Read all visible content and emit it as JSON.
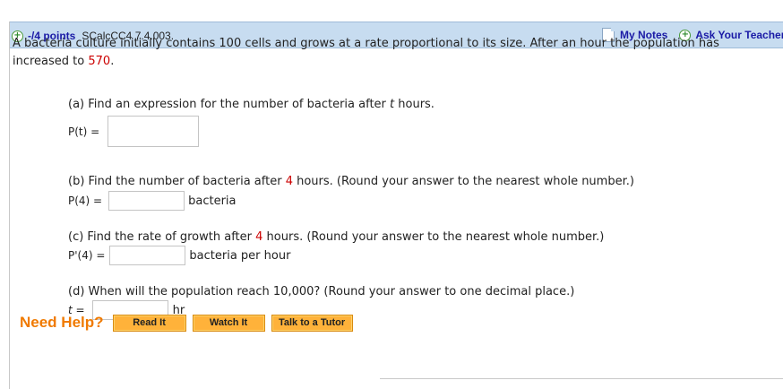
{
  "header": {
    "points": "-/4 points",
    "question_id": "SCalcCC4 7.4.003.",
    "my_notes": "My Notes",
    "ask_teacher": "Ask Your Teacher"
  },
  "problem": {
    "text": "A bacteria culture initially contains 100 cells and grows at a rate proportional to its size. After an hour the population has increased to ",
    "value": "570",
    "end": "."
  },
  "part_a": {
    "prompt_start": "(a) Find an expression for the number of bacteria after ",
    "var": "t",
    "prompt_end": " hours.",
    "label": "P(t) =",
    "value": ""
  },
  "part_b": {
    "prompt_start": "(b) Find the number of bacteria after ",
    "hours": "4",
    "prompt_end": " hours. (Round your answer to the nearest whole number.)",
    "label": "P(4) =",
    "value": "",
    "unit": "bacteria"
  },
  "part_c": {
    "prompt_start": "(c) Find the rate of growth after ",
    "hours": "4",
    "prompt_end": " hours. (Round your answer to the nearest whole number.)",
    "label": "P'(4) =",
    "value": "",
    "unit": "bacteria per hour"
  },
  "part_d": {
    "prompt": "(d) When will the population reach 10,000? (Round your answer to one decimal place.)",
    "label": "t =",
    "value": "",
    "unit": "hr"
  },
  "help": {
    "label": "Need Help?",
    "read": "Read It",
    "watch": "Watch It",
    "tutor": "Talk to a Tutor"
  }
}
